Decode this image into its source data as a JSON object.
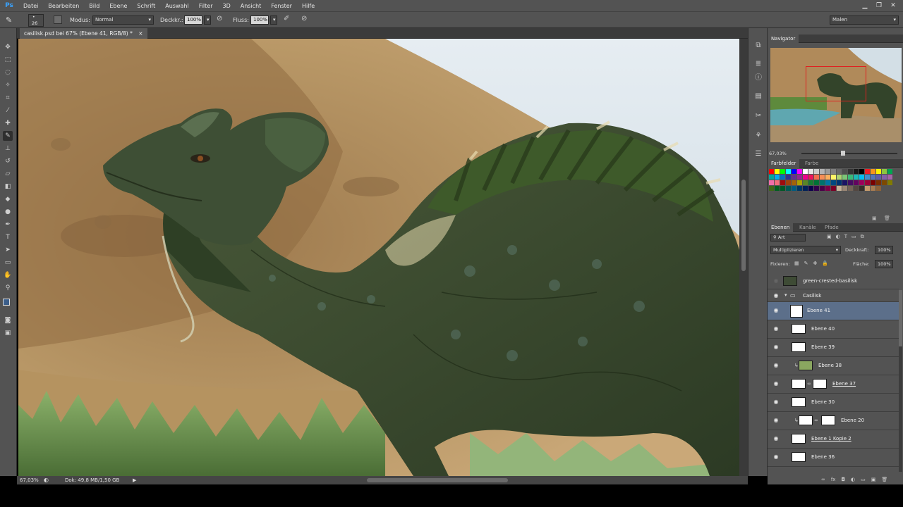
{
  "app": {
    "logo": "Ps"
  },
  "menu": [
    "Datei",
    "Bearbeiten",
    "Bild",
    "Ebene",
    "Schrift",
    "Auswahl",
    "Filter",
    "3D",
    "Ansicht",
    "Fenster",
    "Hilfe"
  ],
  "window_controls": {
    "minimize": "▁",
    "restore": "❐",
    "close": "✕"
  },
  "options": {
    "brush_size": "26",
    "mode_label": "Modus:",
    "mode_value": "Normal",
    "opacity_label": "Deckkr.:",
    "opacity_value": "100%",
    "flow_label": "Fluss:",
    "flow_value": "100%",
    "workspace": "Malen"
  },
  "document": {
    "tab_title": "casilisk.psd bei 67% (Ebene 41, RGB/8) *",
    "close": "×"
  },
  "status": {
    "zoom": "67,03%",
    "doc": "Dok: 49,8 MB/1,50 GB",
    "arrow": "▶"
  },
  "navigator": {
    "title": "Navigator",
    "zoom": "67,03%"
  },
  "color_panel": {
    "tabs": [
      "Farbfelder",
      "Farbe"
    ]
  },
  "swatch_colors": [
    "#ff0000",
    "#ffff00",
    "#00ff00",
    "#00ffff",
    "#0000ff",
    "#ff00ff",
    "#ffffff",
    "#e6e6e6",
    "#cccccc",
    "#b3b3b3",
    "#999999",
    "#808080",
    "#666666",
    "#4d4d4d",
    "#333333",
    "#1a1a1a",
    "#000000",
    "#ed1c24",
    "#f7941d",
    "#fff200",
    "#8dc63f",
    "#00a651",
    "#00a99d",
    "#00aeef",
    "#0072bc",
    "#2e3192",
    "#662d91",
    "#92278f",
    "#ec008c",
    "#ed145b",
    "#f26c4f",
    "#f68e56",
    "#fbaf5d",
    "#fff568",
    "#acd372",
    "#7cc576",
    "#3bb878",
    "#1abbb4",
    "#00bff3",
    "#438ccb",
    "#5574b9",
    "#605ca8",
    "#855fa8",
    "#a763a8",
    "#f06eaa",
    "#f26d7d",
    "#9e0b0f",
    "#a0410d",
    "#a36209",
    "#aba000",
    "#598527",
    "#1a7b30",
    "#007236",
    "#00746b",
    "#0076a3",
    "#004a80",
    "#003471",
    "#1b1464",
    "#440e62",
    "#630460",
    "#9e005d",
    "#9e0039",
    "#790000",
    "#7b2e00",
    "#7d4900",
    "#827b00",
    "#406618",
    "#005e20",
    "#005826",
    "#005952",
    "#005b7f",
    "#003663",
    "#002157",
    "#0d004c",
    "#32004b",
    "#4b0049",
    "#7b0046",
    "#7a0026",
    "#c7b299",
    "#998675",
    "#736357",
    "#534741",
    "#37302a",
    "#c69c6d",
    "#a67c52",
    "#8c6239"
  ],
  "layers_panel": {
    "tabs": [
      "Ebenen",
      "Kanäle",
      "Pfade"
    ],
    "filter_label": "Art",
    "blend_mode": "Multiplizieren",
    "opacity_label": "Deckkraft:",
    "opacity_value": "100%",
    "lock_label": "Fixieren:",
    "fill_label": "Fläche:",
    "fill_value": "100%",
    "layers": [
      {
        "name": "green-crested-basilisk"
      },
      {
        "name": "Casilisk"
      },
      {
        "name": "Ebene 41"
      },
      {
        "name": "Ebene 40"
      },
      {
        "name": "Ebene 39"
      },
      {
        "name": "Ebene 38"
      },
      {
        "name": "Ebene 37"
      },
      {
        "name": "Ebene 30"
      },
      {
        "name": "Ebene 20"
      },
      {
        "name": "Ebene 1 Kopie 2"
      },
      {
        "name": "Ebene 36"
      }
    ]
  }
}
